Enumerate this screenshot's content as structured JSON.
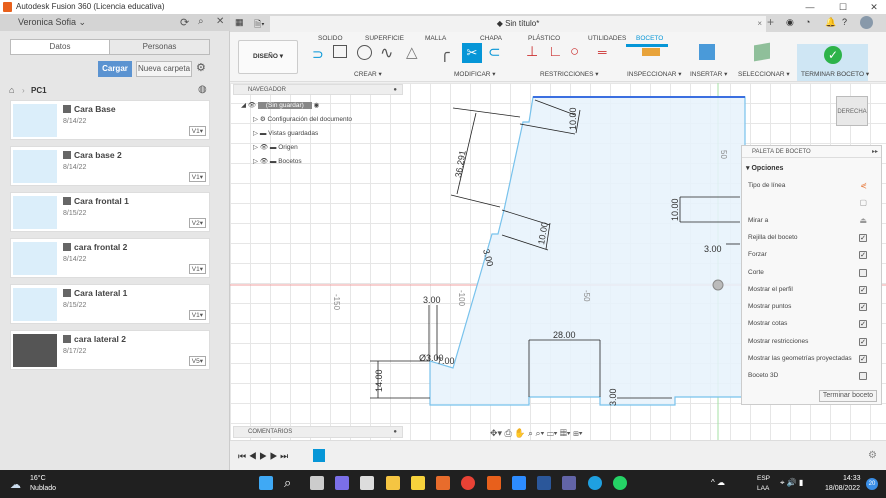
{
  "window": {
    "title": "Autodesk Fusion 360 (Licencia educativa)",
    "minimize": "—",
    "maximize": "☐",
    "close": "✕"
  },
  "left_panel": {
    "user": "Veronica Sofia",
    "tabs": [
      "Datos",
      "Personas"
    ],
    "upload": "Cargar",
    "new_folder": "Nueva carpeta",
    "breadcrumb": "PC1",
    "files": [
      {
        "name": "Cara Base",
        "date": "8/14/22",
        "version": "V1▾"
      },
      {
        "name": "Cara base 2",
        "date": "8/14/22",
        "version": "V1▾"
      },
      {
        "name": "Cara frontal 1",
        "date": "8/15/22",
        "version": "V2▾"
      },
      {
        "name": "cara frontal 2",
        "date": "8/14/22",
        "version": "V1▾"
      },
      {
        "name": "Cara lateral 1",
        "date": "8/15/22",
        "version": "V1▾"
      },
      {
        "name": "cara lateral 2",
        "date": "8/17/22",
        "version": "V5▾"
      }
    ]
  },
  "document": {
    "title": "Sin título*",
    "close": "×"
  },
  "ribbon": {
    "workspace": "DISEÑO ▾",
    "tabs": [
      "SOLIDO",
      "SUPERFICIE",
      "MALLA",
      "CHAPA",
      "PLÁSTICO",
      "UTILIDADES",
      "BOCETO"
    ],
    "active_tab": "BOCETO",
    "groups": [
      "CREAR ▾",
      "MODIFICAR ▾",
      "RESTRICCIONES ▾",
      "INSPECCIONAR ▾",
      "INSERTAR ▾",
      "SELECCIONAR ▾",
      "TERMINAR BOCETO ▾"
    ],
    "accent": "#0696d7",
    "finish_color": "#2db34a"
  },
  "navigator": {
    "title": "NAVEGADOR",
    "root": "(Sin guardar)",
    "items": [
      "Configuración del documento",
      "Vistas guardadas",
      "Origen",
      "Bocetos"
    ]
  },
  "viewcube": "DERECHA",
  "dimensions": [
    "36.291",
    "10.00",
    "10.00",
    "3.00",
    "10.00",
    "3.00",
    "Ø3.00",
    "7.00",
    "14.00",
    "28.00",
    "3.00",
    "3.00"
  ],
  "axis_labels": [
    "-150",
    "-100",
    "-50",
    "50"
  ],
  "palette": {
    "title": "PALETA DE BOCETO",
    "section": "Opciones",
    "rows": [
      {
        "label": "Tipo de línea",
        "type": "icon"
      },
      {
        "label": "",
        "type": "icon"
      },
      {
        "label": "Mirar a",
        "type": "icon"
      },
      {
        "label": "Rejilla del boceto",
        "checked": true
      },
      {
        "label": "Forzar",
        "checked": true
      },
      {
        "label": "Corte",
        "checked": false
      },
      {
        "label": "Mostrar el perfil",
        "checked": true
      },
      {
        "label": "Mostrar puntos",
        "checked": true
      },
      {
        "label": "Mostrar cotas",
        "checked": true
      },
      {
        "label": "Mostrar restricciones",
        "checked": true
      },
      {
        "label": "Mostrar las geometrías proyectadas",
        "checked": true
      },
      {
        "label": "Boceto 3D",
        "checked": false
      }
    ],
    "finish": "Terminar boceto"
  },
  "comments": "COMENTARIOS",
  "taskbar": {
    "temp": "16°C",
    "weather": "Nublado",
    "lang1": "ESP",
    "lang2": "LAA",
    "time": "14:33",
    "date": "18/08/2022",
    "notif": "20"
  }
}
